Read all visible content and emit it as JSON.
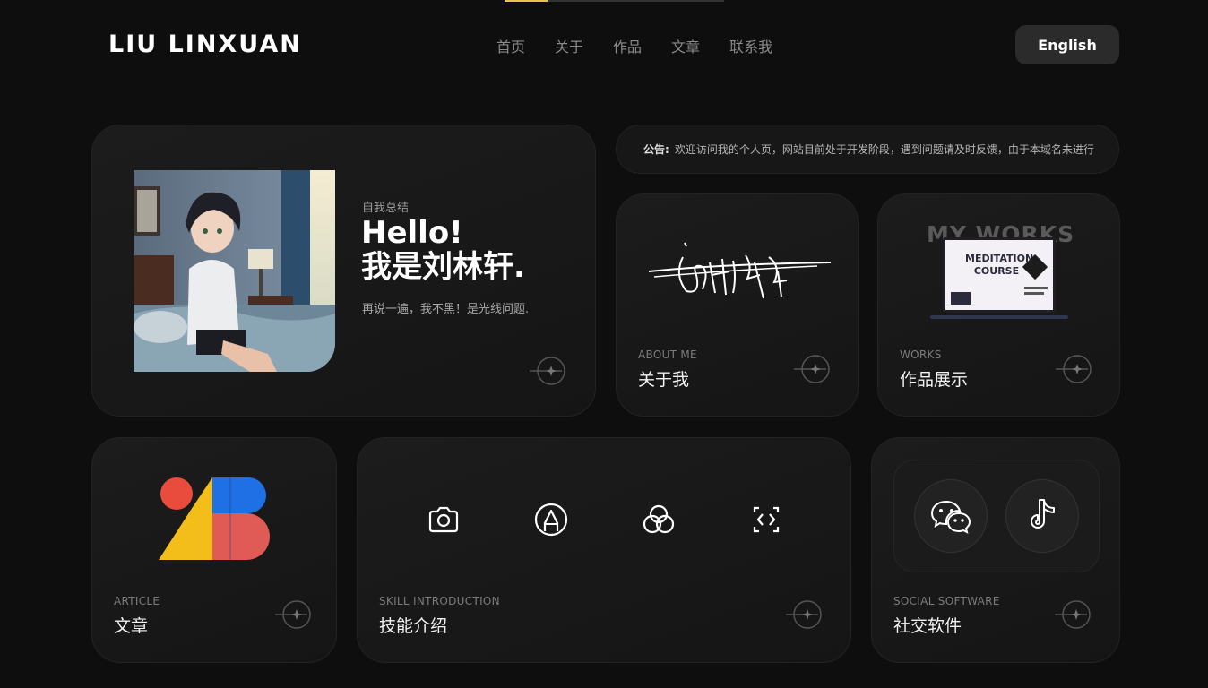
{
  "header": {
    "logo": "LIU LINXUAN",
    "nav": [
      "首页",
      "关于",
      "作品",
      "文章",
      "联系我"
    ],
    "lang_button": "English"
  },
  "hero": {
    "label": "自我总结",
    "greeting_line1": "Hello!",
    "greeting_line2": "我是刘林轩.",
    "description": "再说一遍，我不黑！是光线问题."
  },
  "notice": {
    "prefix": "公告:",
    "text": "欢迎访问我的个人页，网站目前处于开发阶段，遇到问题请及时反馈，由于本域名未进行"
  },
  "cards": {
    "about": {
      "sub": "ABOUT ME",
      "title": "关于我"
    },
    "works": {
      "sub": "WORKS",
      "title": "作品展示",
      "banner": "MY WORKS",
      "screen_title": "MEDITATION COURSE"
    },
    "article": {
      "sub": "ARTICLE",
      "title": "文章"
    },
    "skill": {
      "sub": "SKILL INTRODUCTION",
      "title": "技能介绍",
      "icons": [
        "camera-icon",
        "pen-icon",
        "color-circles-icon",
        "code-brackets-icon"
      ]
    },
    "social": {
      "sub": "SOCIAL SOFTWARE",
      "title": "社交软件",
      "icons": [
        "wechat-icon",
        "tiktok-icon"
      ]
    }
  },
  "colors": {
    "background": "#0e0e0e",
    "card": "#1a1a1a",
    "accent": "#e6c34a",
    "muted": "#7c7c7c"
  }
}
